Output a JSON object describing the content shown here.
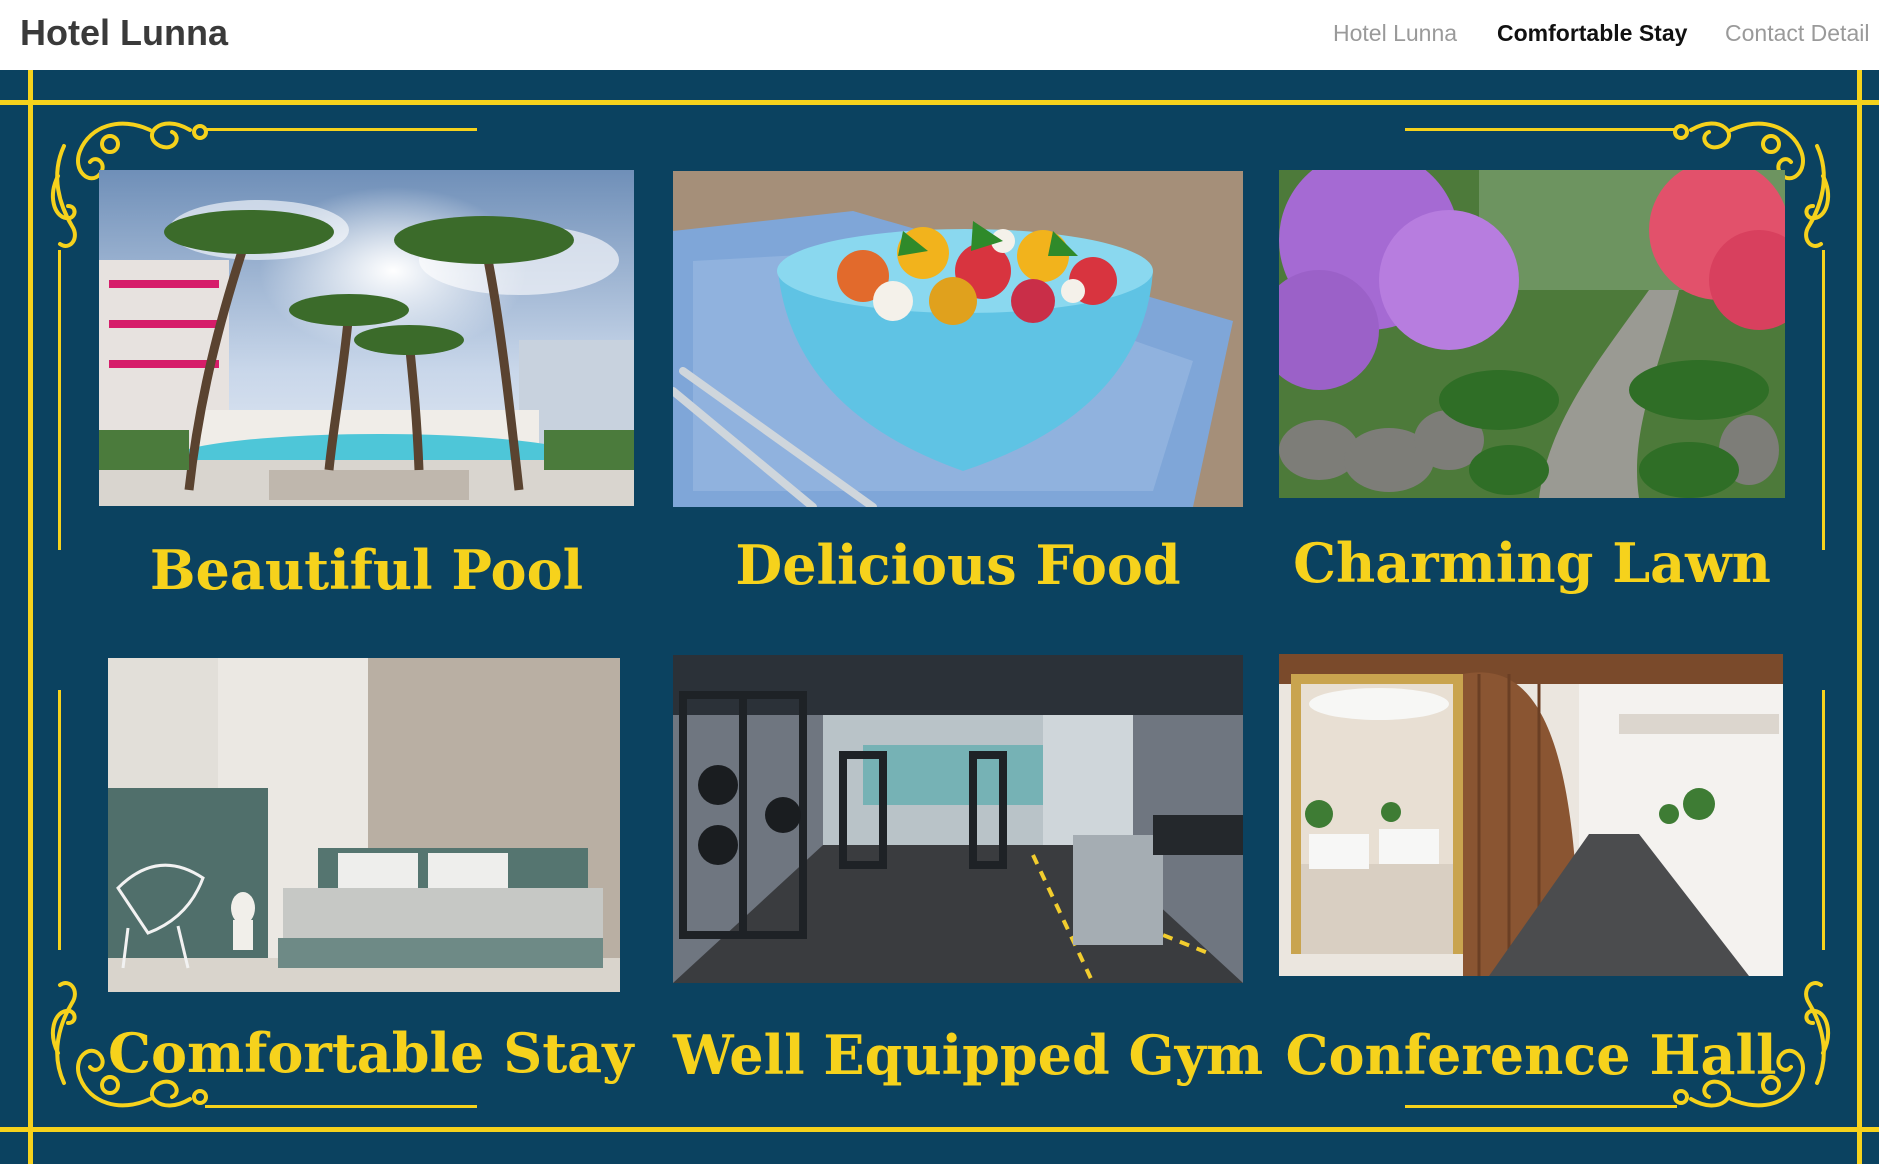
{
  "header": {
    "brand": "Hotel Lunna",
    "nav": [
      {
        "label": "Hotel Lunna",
        "active": false
      },
      {
        "label": "Comfortable Stay",
        "active": true
      },
      {
        "label": "Contact Detail",
        "active": false
      }
    ]
  },
  "colors": {
    "panel_background": "#0b4260",
    "gold_accent": "#f6d21c",
    "header_background": "#ffffff"
  },
  "features": [
    {
      "title": "Beautiful Pool",
      "image": "pool-photo"
    },
    {
      "title": "Delicious Food",
      "image": "salad-bowl-photo"
    },
    {
      "title": "Charming Lawn",
      "image": "garden-path-photo"
    },
    {
      "title": "Comfortable Stay",
      "image": "bedroom-photo"
    },
    {
      "title": "Well Equipped Gym",
      "image": "gym-photo"
    },
    {
      "title": "Conference Hall",
      "image": "lobby-photo"
    }
  ]
}
